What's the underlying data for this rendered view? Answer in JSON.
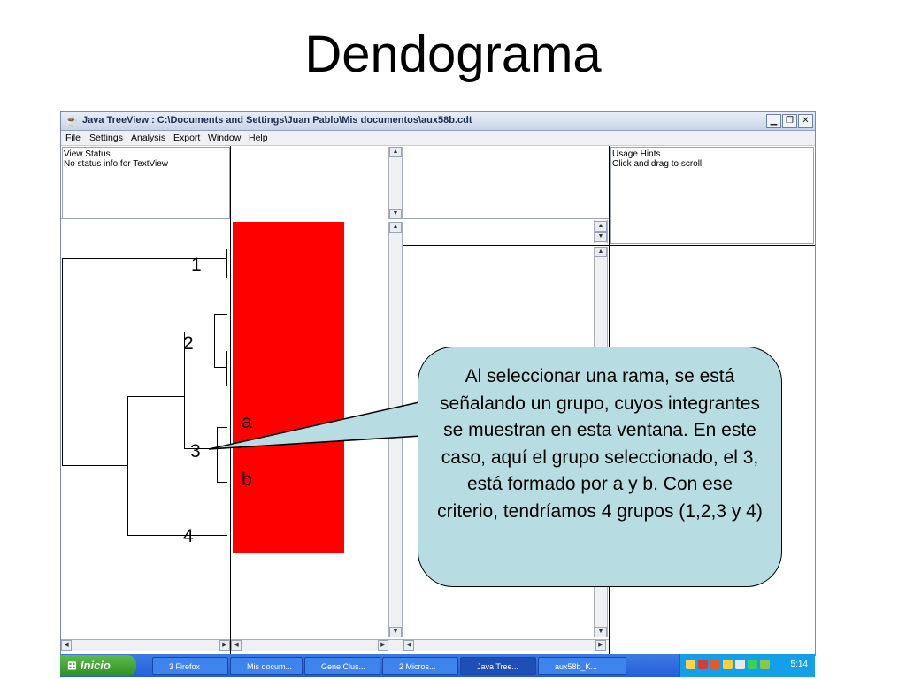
{
  "slide": {
    "title": "Dendograma"
  },
  "window": {
    "title": "Java TreeView : C:\\Documents and Settings\\Juan Pablo\\Mis documentos\\aux58b.cdt",
    "menu": [
      "File",
      "Settings",
      "Analysis",
      "Export",
      "Window",
      "Help"
    ],
    "view_status": "View Status\nNo status info for TextView",
    "usage_hints": "Usage Hints\nClick and drag to scroll"
  },
  "dendrogram": {
    "leaf_numbers": [
      "1",
      "2",
      "3",
      "4"
    ],
    "leaf_letters": [
      "a",
      "b"
    ],
    "heatmap_color": "#ff0000"
  },
  "callout": {
    "text": "Al seleccionar una rama, se está señalando un grupo, cuyos integrantes se muestran en esta ventana. En este caso, aquí el grupo seleccionado, el 3, está formado por a y b. Con ese criterio, tendríamos 4 grupos (1,2,3 y 4)",
    "fill": "#b7dde2"
  },
  "taskbar": {
    "start_label": "Inicio",
    "tasks": [
      "3 Firefox",
      "Mis docum...",
      "Gene Clus...",
      "2 Micros...",
      "Java Tree...",
      "aux58b_K..."
    ],
    "clock": "5:14"
  }
}
